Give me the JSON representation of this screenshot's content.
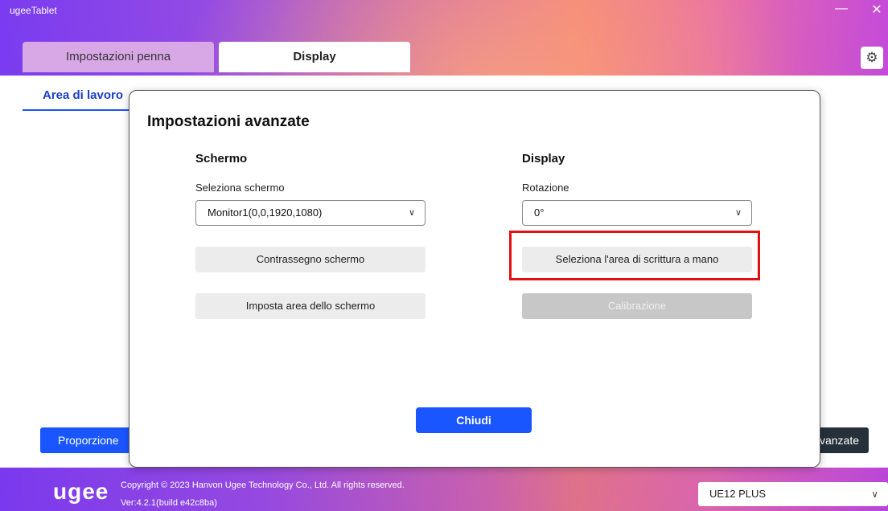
{
  "app": {
    "title": "ugeeTablet",
    "min_glyph": "—",
    "close_glyph": "✕"
  },
  "tabs": {
    "pen_settings": "Impostazioni penna",
    "display": "Display"
  },
  "content": {
    "subtab_label": "Area di lavoro",
    "proportion_button": "Proporzione",
    "advanced_button": "Avanzate"
  },
  "modal": {
    "title": "Impostazioni avanzate",
    "screen": {
      "heading": "Schermo",
      "select_label": "Seleziona schermo",
      "select_value": "Monitor1(0,0,1920,1080)",
      "mark_button": "Contrassegno schermo",
      "area_button": "Imposta area dello schermo"
    },
    "display": {
      "heading": "Display",
      "rotation_label": "Rotazione",
      "rotation_value": "0°",
      "handwriting_button": "Seleziona l'area di scrittura a mano",
      "calibration_button": "Calibrazione"
    },
    "close_button": "Chiudi"
  },
  "footer": {
    "logo": "ugee",
    "copyright": "Copyright © 2023 Hanvon Ugee Technology Co., Ltd. All rights reserved.",
    "version": "Ver:4.2.1(build e42c8ba)",
    "device": "UE12 PLUS"
  },
  "icons": {
    "settings": "gear-icon",
    "dropdown": "chevron-down-icon"
  },
  "colors": {
    "accent": "#1a56ff",
    "highlight": "#e41010"
  }
}
